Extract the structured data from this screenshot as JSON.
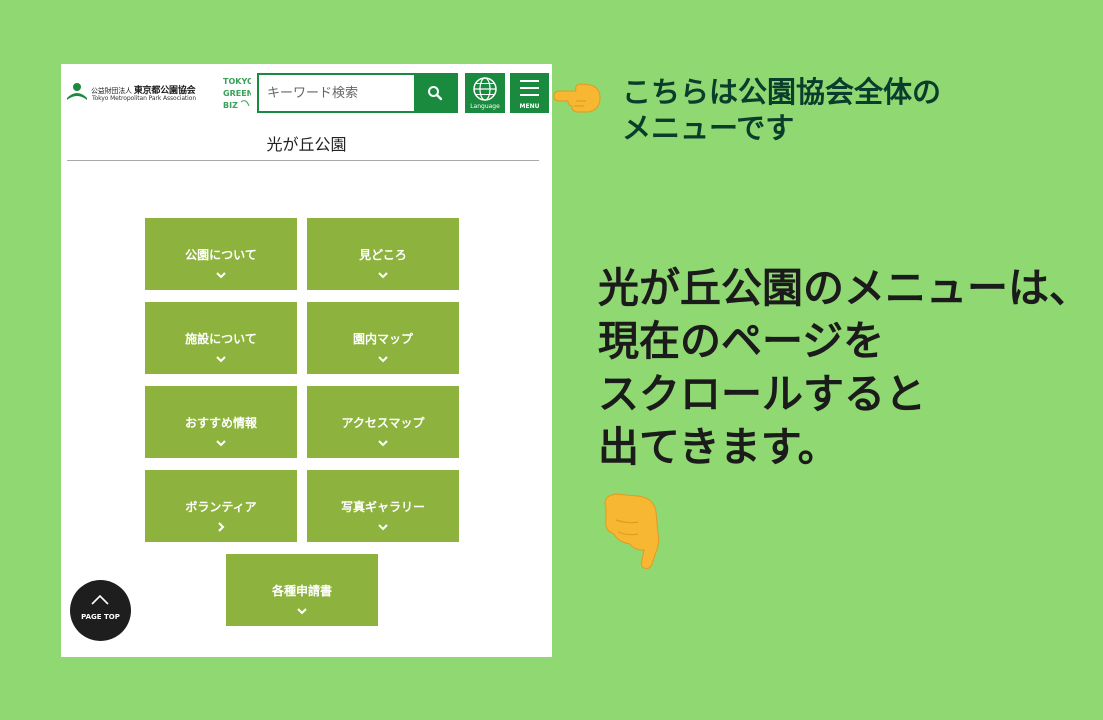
{
  "header": {
    "logo_org_type": "公益財団法人",
    "logo_name": "東京都公園協会",
    "logo_english": "Tokyo Metropolitan Park Association",
    "search_placeholder": "キーワード検索",
    "language_label": "Language",
    "menu_label": "MENU"
  },
  "park_title": "光が丘公園",
  "menu_tiles": [
    {
      "label": "公園について",
      "chevron": "chevron-down"
    },
    {
      "label": "見どころ",
      "chevron": "chevron-down"
    },
    {
      "label": "施設について",
      "chevron": "chevron-down"
    },
    {
      "label": "園内マップ",
      "chevron": "chevron-down"
    },
    {
      "label": "おすすめ情報",
      "chevron": "chevron-down"
    },
    {
      "label": "アクセスマップ",
      "chevron": "chevron-down"
    },
    {
      "label": "ボランティア",
      "chevron": "chevron-right"
    },
    {
      "label": "写真ギャラリー",
      "chevron": "chevron-down"
    },
    {
      "label": "各種申請書",
      "chevron": "chevron-down"
    }
  ],
  "page_top_label": "PAGE TOP",
  "callout_menu": {
    "line1": "こちらは公園協会全体の",
    "line2": "メニューです"
  },
  "callout_scroll": {
    "line1": "光が丘公園のメニューは、",
    "line2": "現在のページを",
    "line3": "スクロールすると",
    "line4": "出てきます。"
  },
  "colors": {
    "background": "#8fd872",
    "header_green": "#1a8a3e",
    "tile_green": "#8db33e",
    "callout_dark": "#0a3d2c"
  }
}
